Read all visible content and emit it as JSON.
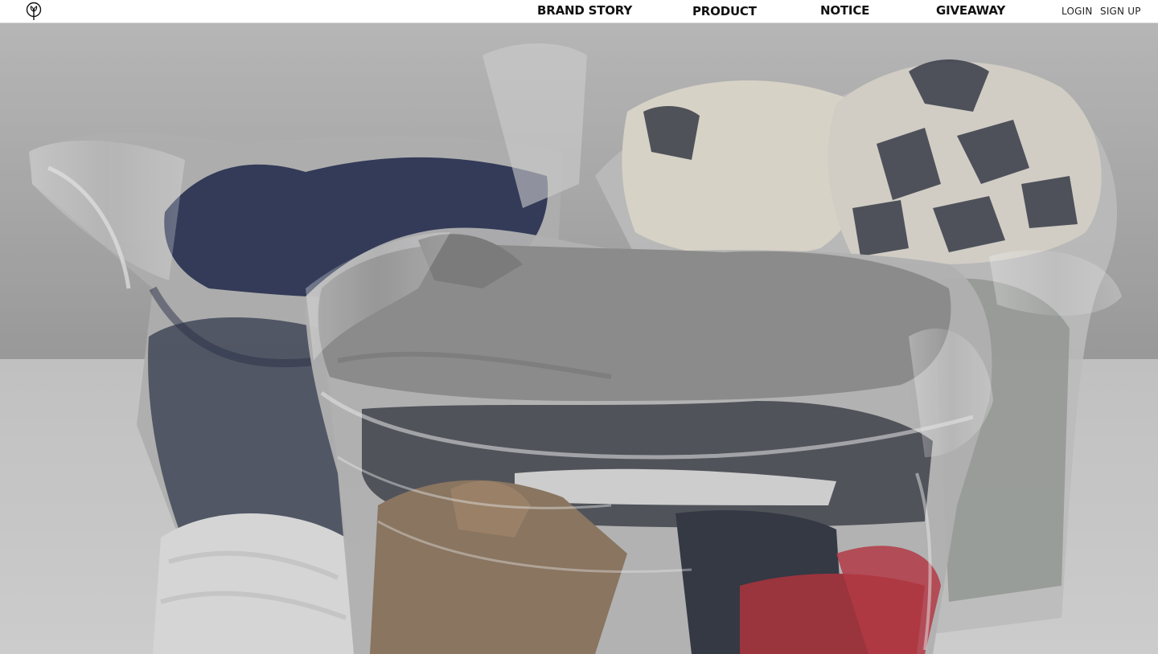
{
  "header": {
    "logo_icon": "tree-circle-logo-icon",
    "nav": {
      "brand_story": "BRAND STORY",
      "product": "PRODUCT",
      "notice": "NOTICE",
      "giveaway": "GIVEAWAY"
    },
    "utility": {
      "login": "LOGIN",
      "sign_up": "SIGN UP"
    }
  },
  "hero": {
    "image": "clothes-in-plastic-bags-photo"
  }
}
